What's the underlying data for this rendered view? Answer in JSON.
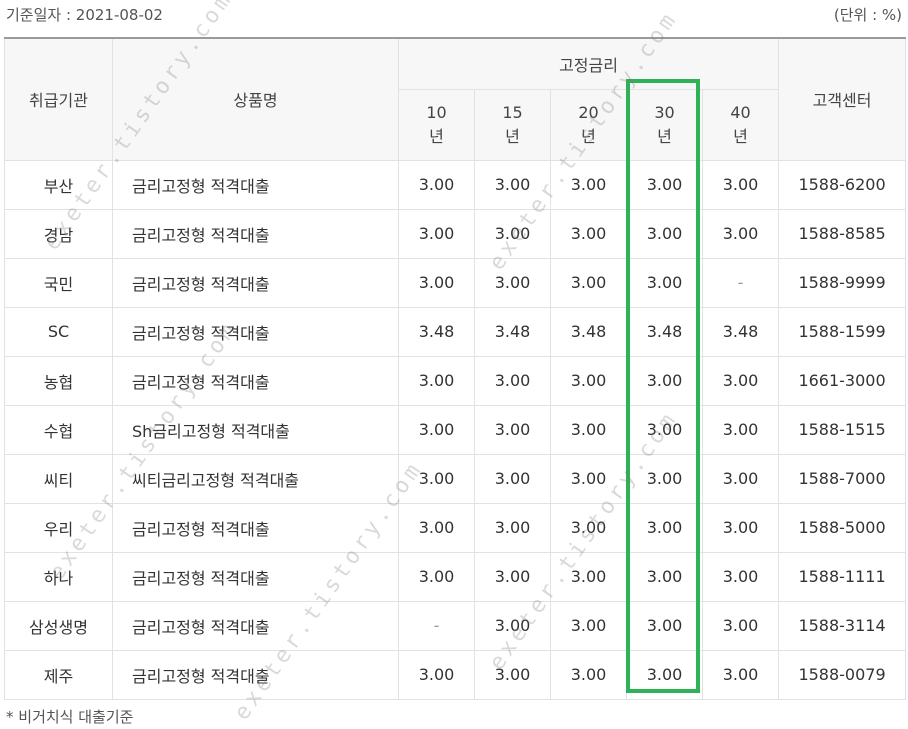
{
  "header": {
    "base_date": "기준일자 : 2021-08-02",
    "unit": "(단위 : %)"
  },
  "table": {
    "col_institution": "취급기관",
    "col_product": "상품명",
    "col_fixed_rate": "고정금리",
    "col_service_center": "고객센터",
    "terms": [
      "10년",
      "15년",
      "20년",
      "30년",
      "40년"
    ],
    "term_numbers": [
      "10",
      "15",
      "20",
      "30",
      "40"
    ],
    "term_suffix": "년",
    "highlighted_term": "30년",
    "highlight_color": "#2fb158",
    "rows": [
      {
        "institution": "부산",
        "product": "금리고정형 적격대출",
        "rates": [
          "3.00",
          "3.00",
          "3.00",
          "3.00",
          "3.00"
        ],
        "phone": "1588-6200"
      },
      {
        "institution": "경남",
        "product": "금리고정형 적격대출",
        "rates": [
          "3.00",
          "3.00",
          "3.00",
          "3.00",
          "3.00"
        ],
        "phone": "1588-8585"
      },
      {
        "institution": "국민",
        "product": "금리고정형 적격대출",
        "rates": [
          "3.00",
          "3.00",
          "3.00",
          "3.00",
          "-"
        ],
        "phone": "1588-9999"
      },
      {
        "institution": "SC",
        "product": "금리고정형 적격대출",
        "rates": [
          "3.48",
          "3.48",
          "3.48",
          "3.48",
          "3.48"
        ],
        "phone": "1588-1599"
      },
      {
        "institution": "농협",
        "product": "금리고정형 적격대출",
        "rates": [
          "3.00",
          "3.00",
          "3.00",
          "3.00",
          "3.00"
        ],
        "phone": "1661-3000"
      },
      {
        "institution": "수협",
        "product": "Sh금리고정형 적격대출",
        "rates": [
          "3.00",
          "3.00",
          "3.00",
          "3.00",
          "3.00"
        ],
        "phone": "1588-1515"
      },
      {
        "institution": "씨티",
        "product": "씨티금리고정형 적격대출",
        "rates": [
          "3.00",
          "3.00",
          "3.00",
          "3.00",
          "3.00"
        ],
        "phone": "1588-7000"
      },
      {
        "institution": "우리",
        "product": "금리고정형 적격대출",
        "rates": [
          "3.00",
          "3.00",
          "3.00",
          "3.00",
          "3.00"
        ],
        "phone": "1588-5000"
      },
      {
        "institution": "하나",
        "product": "금리고정형 적격대출",
        "rates": [
          "3.00",
          "3.00",
          "3.00",
          "3.00",
          "3.00"
        ],
        "phone": "1588-1111"
      },
      {
        "institution": "삼성생명",
        "product": "금리고정형 적격대출",
        "rates": [
          "-",
          "3.00",
          "3.00",
          "3.00",
          "3.00"
        ],
        "phone": "1588-3114"
      },
      {
        "institution": "제주",
        "product": "금리고정형 적격대출",
        "rates": [
          "3.00",
          "3.00",
          "3.00",
          "3.00",
          "3.00"
        ],
        "phone": "1588-0079"
      }
    ]
  },
  "footnote": "* 비거치식 대출기준",
  "watermark": "exeter.tistory.com"
}
